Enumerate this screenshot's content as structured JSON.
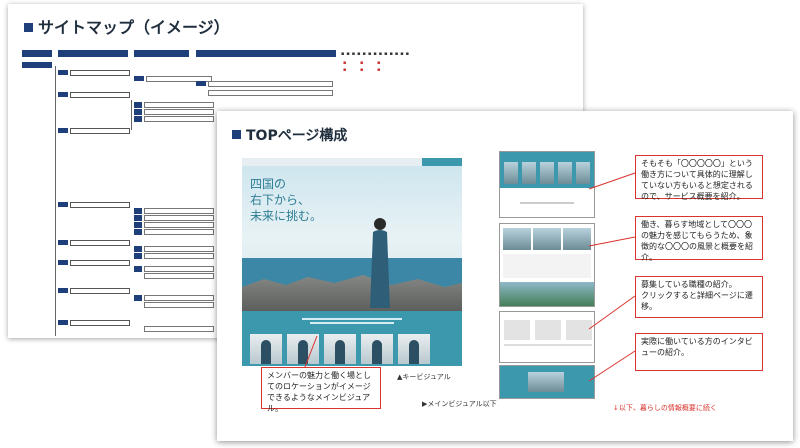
{
  "back_slide": {
    "title": "サイトマップ（イメージ）"
  },
  "front_slide": {
    "title": "TOPページ構成",
    "hero_copy": [
      "四国の",
      "右下から、",
      "未来に挑む。"
    ],
    "callout_main": "メンバーの魅力と働く場としてのロケーションがイメージできるようなメインビジュアル。",
    "label_key_visual": "▲キービジュアル",
    "label_below_main": "▶メインビジュアル以下",
    "label_continue": "↓以下、暮らしの情報概要に続く",
    "callouts": [
      "そもそも「〇〇〇〇〇」という働き方について具体的に理解していない方もいると想定されるので、サービス概要を紹介。",
      "働き、暮らす地域として〇〇〇の魅力を感じてもらうため、象徴的な〇〇〇の風景と概要を紹介。",
      "募集している職種の紹介。\nクリックすると詳細ページに遷移。",
      "実際に働いている方のインタビューの紹介。"
    ]
  },
  "colors": {
    "navy": "#1e3f7a",
    "red": "#d9332d",
    "teal": "#3b98ad"
  }
}
